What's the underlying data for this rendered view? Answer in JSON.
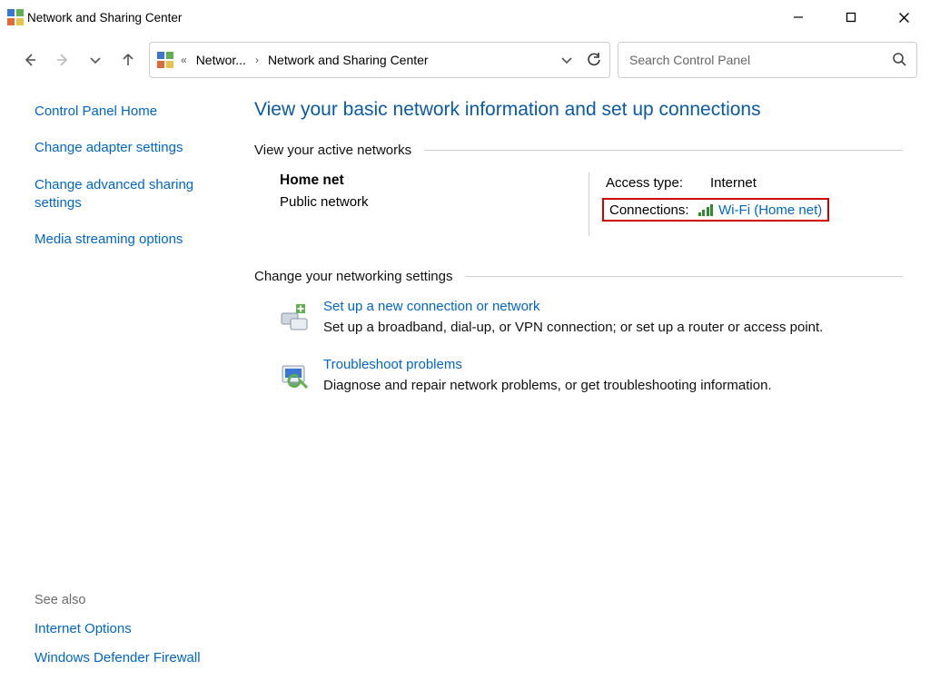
{
  "window": {
    "title": "Network and Sharing Center"
  },
  "breadcrumb": {
    "ellipsis": "«",
    "item1": "Networ...",
    "item2": "Network and Sharing Center"
  },
  "search": {
    "placeholder": "Search Control Panel"
  },
  "sidebar": {
    "home": "Control Panel Home",
    "adapter": "Change adapter settings",
    "advanced": "Change advanced sharing settings",
    "media": "Media streaming options",
    "see_also": "See also",
    "inet_options": "Internet Options",
    "firewall": "Windows Defender Firewall"
  },
  "main": {
    "title": "View your basic network information and set up connections",
    "section_active": "View your active networks",
    "net": {
      "name": "Home net",
      "type": "Public network",
      "access_label": "Access type:",
      "access_value": "Internet",
      "conn_label": "Connections:",
      "conn_value": "Wi-Fi (Home net)"
    },
    "section_change": "Change your networking settings",
    "task_setup": {
      "title": "Set up a new connection or network",
      "desc": "Set up a broadband, dial-up, or VPN connection; or set up a router or access point."
    },
    "task_trouble": {
      "title": "Troubleshoot problems",
      "desc": "Diagnose and repair network problems, or get troubleshooting information."
    }
  }
}
